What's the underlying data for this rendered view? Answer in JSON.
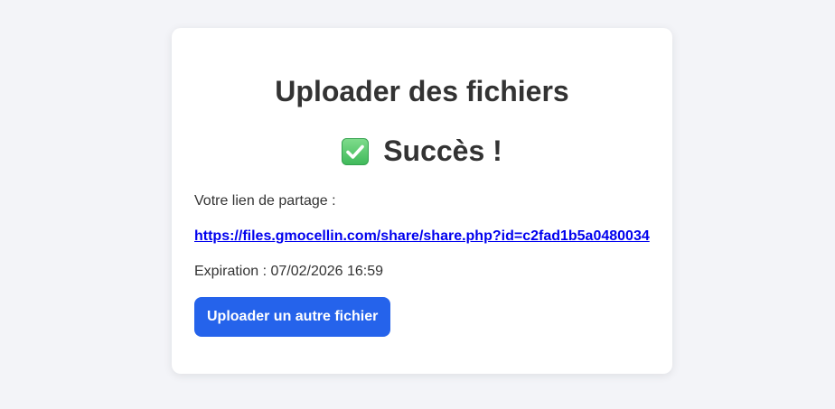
{
  "card": {
    "title": "Uploader des fichiers",
    "success": {
      "icon": "check-mark-button-icon",
      "icon_color": "#5cc96e",
      "text": "Succès !"
    },
    "share_label": "Votre lien de partage :",
    "share_link": "https://files.gmocellin.com/share/share.php?id=c2fad1b5a0480034",
    "expiration_label": "Expiration : ",
    "expiration_value": "07/02/2026 16:59",
    "upload_button_label": "Uploader un autre fichier"
  },
  "colors": {
    "background": "#f3f4f8",
    "card": "#ffffff",
    "text": "#333333",
    "link": "#0000ee",
    "button": "#2563eb",
    "button_text": "#ffffff"
  }
}
